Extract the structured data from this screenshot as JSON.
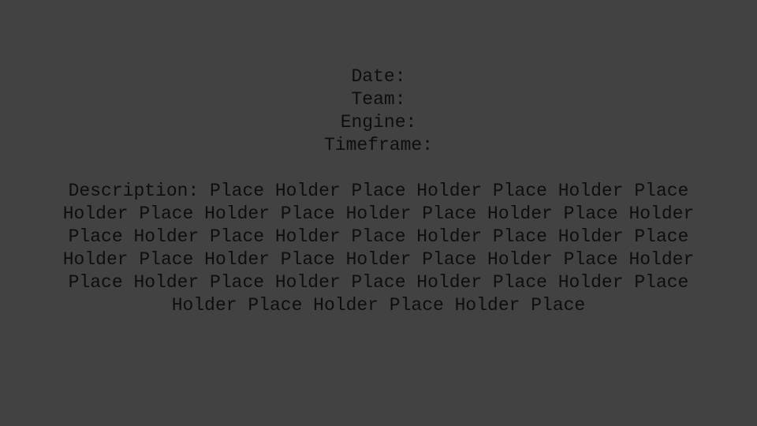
{
  "fields": {
    "date_label": "Date:",
    "team_label": "Team:",
    "engine_label": "Engine:",
    "timeframe_label": "Timeframe:"
  },
  "description": {
    "lines": [
      "Description: Place Holder Place Holder Place Holder Place",
      "Holder Place Holder Place Holder Place Holder Place Holder",
      "Place Holder Place Holder Place Holder Place Holder Place",
      "Holder Place Holder Place Holder Place Holder Place Holder",
      "Place Holder Place Holder Place Holder Place Holder Place",
      "Holder Place Holder Place Holder Place"
    ]
  },
  "colors": {
    "background": "#424242",
    "text": "#0e0e0e"
  }
}
